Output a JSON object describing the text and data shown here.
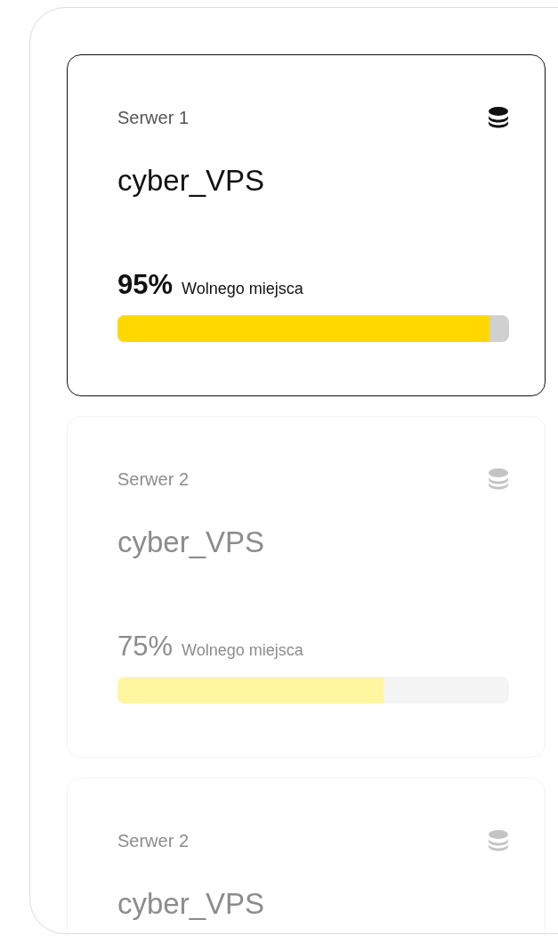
{
  "servers": [
    {
      "label": "Serwer 1",
      "name": "cyber_VPS",
      "selected": true,
      "usage": {
        "percent": "95%",
        "caption": "Wolnego miejsca",
        "level": 0.95
      }
    },
    {
      "label": "Serwer 2",
      "name": "cyber_VPS",
      "selected": false,
      "usage": {
        "percent": "75%",
        "caption": "Wolnego miejsca",
        "level": 0.68
      }
    },
    {
      "label": "Serwer 2",
      "name": "cyber_VPS",
      "selected": false
    }
  ]
}
